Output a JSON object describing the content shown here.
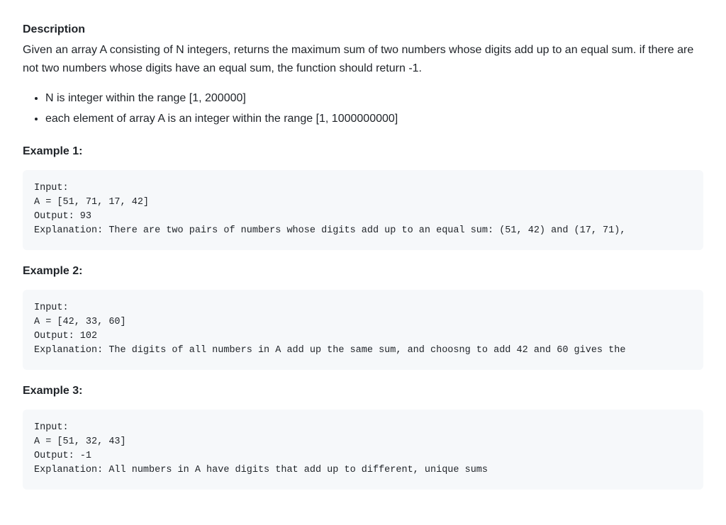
{
  "description": {
    "heading": "Description",
    "text": "Given an array A consisting of N integers, returns the maximum sum of two numbers whose digits add up to an equal sum. if there are not two numbers whose digits have an equal sum, the function should return -1."
  },
  "constraints": [
    "N is integer within the range [1, 200000]",
    "each element of array A is an integer within the range [1, 1000000000]"
  ],
  "examples": [
    {
      "heading": "Example 1:",
      "code": "Input:\nA = [51, 71, 17, 42]\nOutput: 93\nExplanation: There are two pairs of numbers whose digits add up to an equal sum: (51, 42) and (17, 71),"
    },
    {
      "heading": "Example 2:",
      "code": "Input:\nA = [42, 33, 60]\nOutput: 102\nExplanation: The digits of all numbers in A add up the same sum, and choosng to add 42 and 60 gives the"
    },
    {
      "heading": "Example 3:",
      "code": "Input:\nA = [51, 32, 43]\nOutput: -1\nExplanation: All numbers in A have digits that add up to different, unique sums"
    }
  ]
}
